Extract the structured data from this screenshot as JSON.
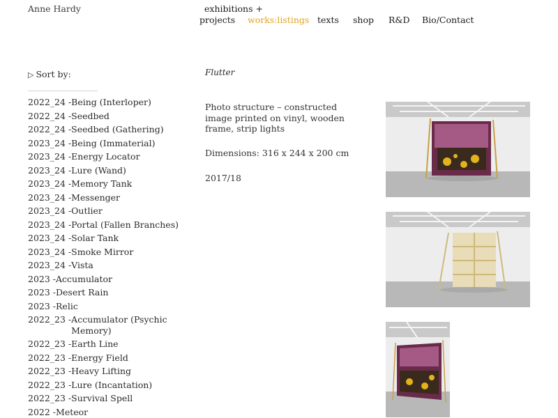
{
  "site": {
    "title": "Anne Hardy"
  },
  "nav": {
    "top_label": "exhibitions +",
    "items": [
      {
        "label": "projects",
        "active": false
      },
      {
        "label": "works:listings",
        "active": true
      },
      {
        "label": "texts",
        "active": false
      },
      {
        "label": "shop",
        "active": false
      },
      {
        "label": "R&D",
        "active": false
      },
      {
        "label": "Bio/Contact",
        "active": false
      }
    ],
    "accent_color": "#e0a520"
  },
  "sidebar": {
    "sort_label": "Sort by:",
    "sort_icon": "triangle-right-icon",
    "works": [
      {
        "year": "2022_24 -",
        "title": "Being (Interloper)"
      },
      {
        "year": "2022_24 -",
        "title": "Seedbed"
      },
      {
        "year": "2022_24 -",
        "title": "Seedbed (Gathering)"
      },
      {
        "year": "2023_24 -",
        "title": "Being (Immaterial)"
      },
      {
        "year": "2023_24 -",
        "title": "Energy Locator"
      },
      {
        "year": "2023_24 -",
        "title": "Lure (Wand)"
      },
      {
        "year": "2023_24 -",
        "title": "Memory Tank"
      },
      {
        "year": "2023_24 -",
        "title": "Messenger"
      },
      {
        "year": "2023_24 -",
        "title": "Outlier"
      },
      {
        "year": "2023_24 -",
        "title": "Portal (Fallen Branches)"
      },
      {
        "year": "2023_24 -",
        "title": "Solar Tank"
      },
      {
        "year": "2023_24 -",
        "title": "Smoke Mirror"
      },
      {
        "year": "2023_24 -",
        "title": "Vista"
      },
      {
        "year": "2023 -",
        "title": "Accumulator"
      },
      {
        "year": "2023 -",
        "title": "Desert Rain"
      },
      {
        "year": "2023 -",
        "title": "Relic"
      },
      {
        "year": "2022_23 -",
        "title": "Accumulator (Psychic Memory)"
      },
      {
        "year": "2022_23 -",
        "title": "Earth Line"
      },
      {
        "year": "2022_23 -",
        "title": "Energy Field"
      },
      {
        "year": "2022_23 -",
        "title": "Heavy Lifting"
      },
      {
        "year": "2022_23 -",
        "title": "Lure (Incantation)"
      },
      {
        "year": "2022_23 -",
        "title": "Survival Spell"
      },
      {
        "year": "2022 -",
        "title": "Meteor"
      }
    ]
  },
  "work": {
    "title": "Flutter",
    "description": "Photo structure – constructed image printed on vinyl, wooden frame, strip lights",
    "dimensions": "Dimensions: 316 x 244 x 200 cm",
    "year": "2017/18"
  }
}
